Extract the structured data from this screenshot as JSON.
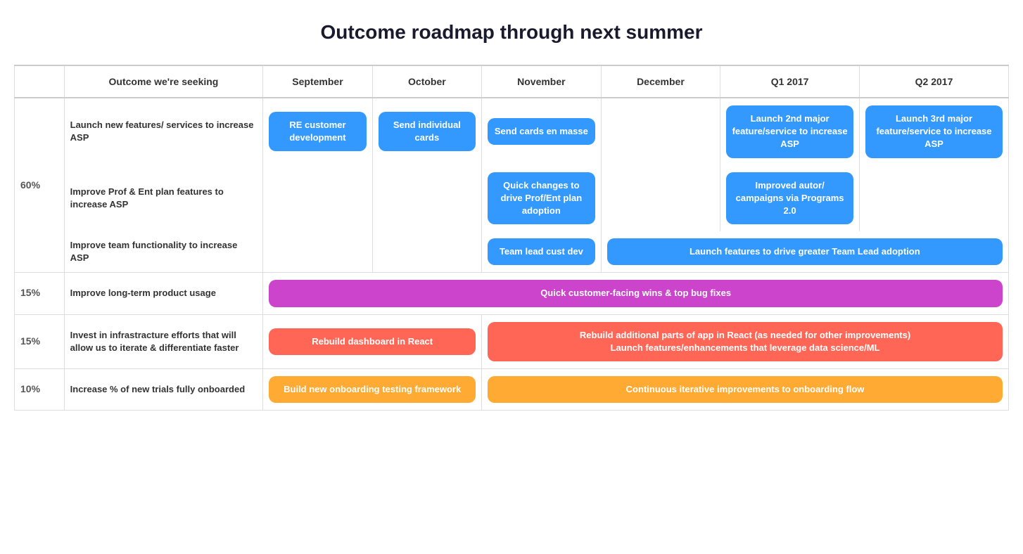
{
  "title": "Outcome roadmap through next summer",
  "header": {
    "col_outcome": "Outcome we're seeking",
    "col_sep": "September",
    "col_oct": "October",
    "col_nov": "November",
    "col_dec": "December",
    "col_q1": "Q1 2017",
    "col_q2": "Q2 2017"
  },
  "rows": [
    {
      "pct": "60%",
      "outcomes": [
        "Launch new features/ services to increase ASP",
        "Improve Prof & Ent plan features to increase ASP",
        "Improve team functionality to increase ASP"
      ],
      "cells": {
        "row1": {
          "sep": "RE customer development",
          "oct": "Send individual cards",
          "nov": "Send cards en masse",
          "dec": "",
          "q1": "Launch 2nd major feature/service to increase ASP",
          "q2": "Launch 3rd major feature/service to increase ASP"
        },
        "row2": {
          "nov": "Quick changes to drive Prof/Ent plan adoption",
          "q1": "Improved autor/ campaigns via Programs 2.0"
        },
        "row3": {
          "nov": "Team lead cust dev",
          "dec_q1": "Launch features to drive greater Team Lead adoption"
        }
      }
    },
    {
      "pct": "15%",
      "outcome": "Improve long-term product usage",
      "span_text": "Quick customer-facing wins & top bug fixes"
    },
    {
      "pct": "15%",
      "outcome": "Invest in infrastracture efforts that will allow us to iterate & differentiate faster",
      "sep_oct": "Rebuild dashboard in React",
      "nov_q2": "Rebuild additional parts of app in React (as needed for other improvements)\nLaunch features/enhancements that leverage data science/ML"
    },
    {
      "pct": "10%",
      "outcome": "Increase % of new trials fully onboarded",
      "sep_oct": "Build new onboarding testing framework",
      "nov_q2": "Continuous iterative improvements to onboarding flow"
    }
  ]
}
